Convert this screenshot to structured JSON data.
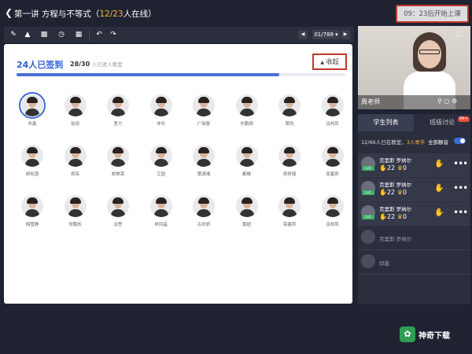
{
  "header": {
    "back_icon": "chevron-left-icon",
    "title_prefix": "第一讲 方程与不等式（",
    "title_online": "12/23",
    "title_suffix": "人在线）",
    "start_button": "09：23后开始上课"
  },
  "toolbar": {
    "tools": [
      "pen-icon",
      "eraser-icon",
      "stamp-icon",
      "clock-icon",
      "chart-icon",
      "undo-icon",
      "redo-icon"
    ],
    "page_prev": "◀",
    "page_indicator": "01/788 ▾",
    "page_next": "▶"
  },
  "checkin": {
    "signed_label": "24人已签到",
    "entered_count": "28/30",
    "entered_label": "人已进入教室",
    "collapse_label": "收起",
    "progress": 0.8
  },
  "students": [
    {
      "name": "布鑫"
    },
    {
      "name": "张叔"
    },
    {
      "name": "吾力"
    },
    {
      "name": "非彤"
    },
    {
      "name": "广瑞客"
    },
    {
      "name": "东鹏卿"
    },
    {
      "name": "翠尚"
    },
    {
      "name": "汝邦凤"
    },
    {
      "name": "郝松茵"
    },
    {
      "name": "郑亮"
    },
    {
      "name": "帧美荣"
    },
    {
      "name": "艾园"
    },
    {
      "name": "蕾潇烯"
    },
    {
      "name": "都楼"
    },
    {
      "name": "祝婷瑾"
    },
    {
      "name": "栾塞莉"
    },
    {
      "name": "梅雪静"
    },
    {
      "name": "党鹏松"
    },
    {
      "name": "汝思"
    },
    {
      "name": "祥凤晶"
    },
    {
      "name": "古欢妍"
    },
    {
      "name": "蕾超"
    },
    {
      "name": "栾塞莉"
    },
    {
      "name": "汝邦凤"
    }
  ],
  "teacher": {
    "name": "周老师",
    "expand_icon": "fullscreen-icon"
  },
  "side_tabs": {
    "students": "学生列表",
    "discussion": "班级讨论",
    "badge": "99+"
  },
  "student_list": {
    "online_text": "12/66人已在教室，",
    "hands_text": "3人举手",
    "mute_label": "全部静音",
    "rows": [
      {
        "name": "克里斯 罗纳尔",
        "likes": "22",
        "cups": "0",
        "level": "Lv1",
        "active": true
      },
      {
        "name": "克里斯 罗纳尔",
        "likes": "22",
        "cups": "0",
        "level": "Lv1",
        "active": true
      },
      {
        "name": "克里斯 罗纳尔",
        "likes": "22",
        "cups": "0",
        "level": "Lv1",
        "active": true
      },
      {
        "name": "克里斯 罗纳尔",
        "active": false
      },
      {
        "name": "邱鑫",
        "active": false
      }
    ]
  },
  "watermark": {
    "text": "神奇下载"
  },
  "colors": {
    "accent": "#3a6bd8",
    "highlight": "#f5b73b",
    "frame": "#c0392b"
  }
}
